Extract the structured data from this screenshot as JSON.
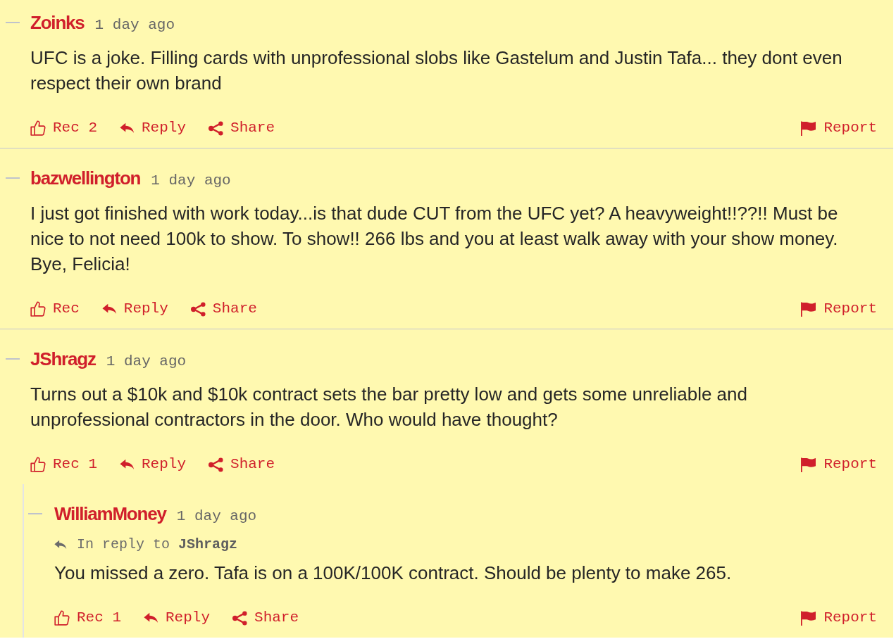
{
  "comments": [
    {
      "author": "Zoinks",
      "time": "1 day ago",
      "body": "UFC is a joke. Filling cards with unprofessional slobs like Gastelum and Justin Tafa... they dont even respect their own brand",
      "actions": {
        "rec": "Rec 2",
        "reply": "Reply",
        "share": "Share",
        "report": "Report"
      }
    },
    {
      "author": "bazwellington",
      "time": "1 day ago",
      "body": "I just got finished with work today...is that dude CUT from the UFC yet? A heavyweight!!??!! Must be nice to not need 100k to show. To show!! 266 lbs and you at least walk away with your show money. Bye, Felicia!",
      "actions": {
        "rec": "Rec",
        "reply": "Reply",
        "share": "Share",
        "report": "Report"
      }
    },
    {
      "author": "JShragz",
      "time": "1 day ago",
      "body": "Turns out a $10k and $10k contract sets the bar pretty low and gets some unreliable and unprofessional contractors in the door. Who would have thought?",
      "actions": {
        "rec": "Rec 1",
        "reply": "Reply",
        "share": "Share",
        "report": "Report"
      },
      "children": [
        {
          "author": "WilliamMoney",
          "time": "1 day ago",
          "in_reply_to": "In reply to **JShragz**",
          "body": "You missed a zero. Tafa is on a 100K/100K contract. Should be plenty to make 265.",
          "actions": {
            "rec": "Rec 1",
            "reply": "Reply",
            "share": "Share",
            "report": "Report"
          }
        }
      ]
    }
  ]
}
